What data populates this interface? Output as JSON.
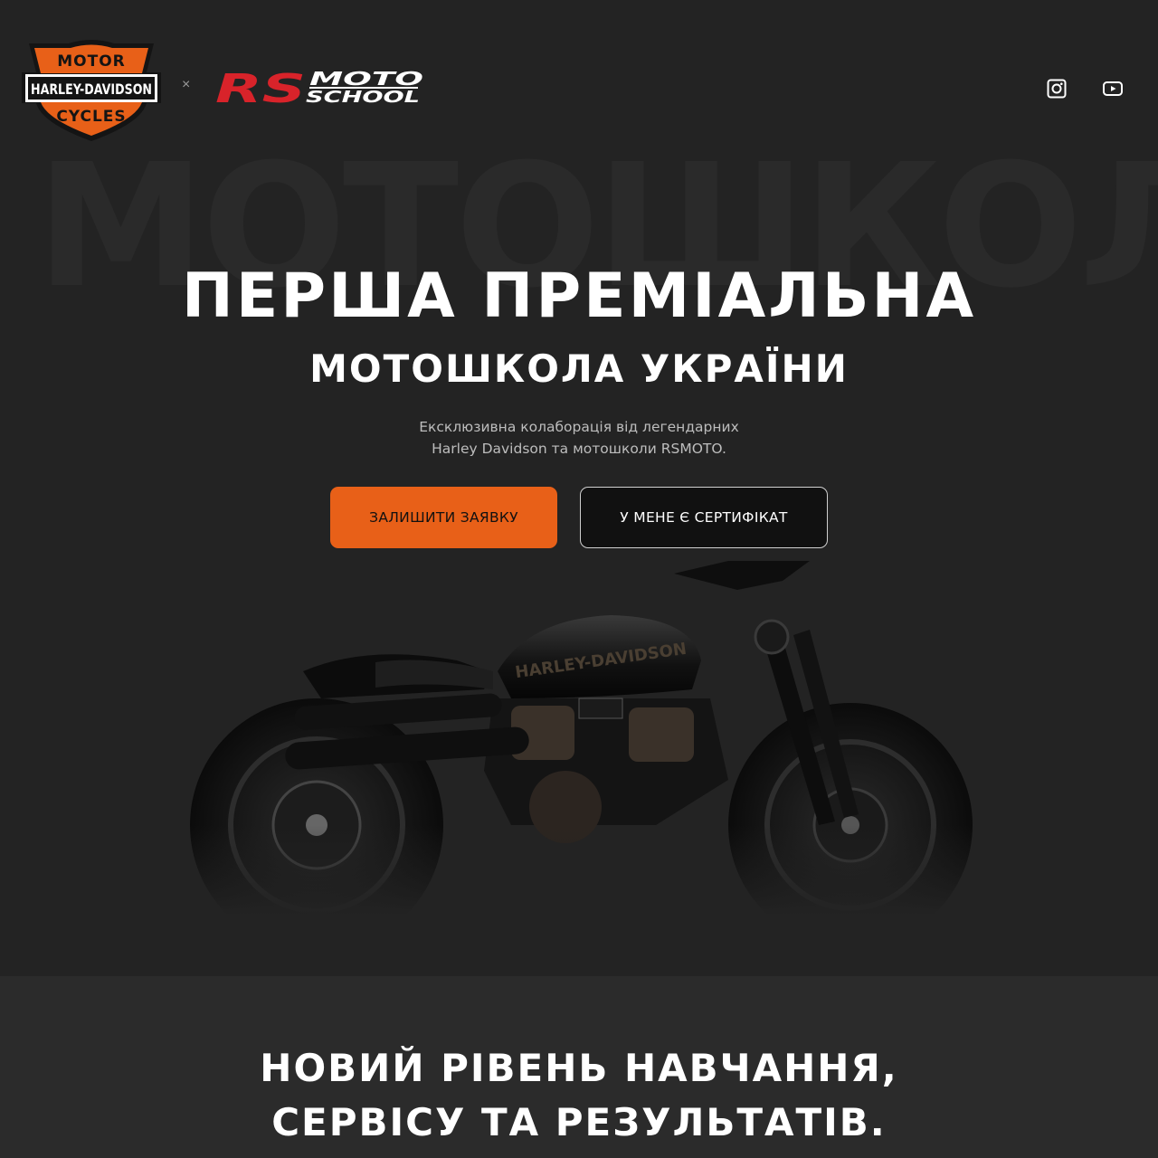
{
  "header": {
    "brand_left": {
      "top": "MOTOR",
      "middle": "HARLEY-DAVIDSON",
      "bottom": "CYCLES"
    },
    "separator": "×",
    "brand_right": {
      "primary": "RS",
      "secondary_top": "MOTO",
      "secondary_bottom": "SCHOOL"
    },
    "social": [
      {
        "name": "instagram-icon"
      },
      {
        "name": "youtube-icon"
      }
    ]
  },
  "hero": {
    "background_word": "МОТОШКОЛА",
    "title": "ПЕРША ПРЕМІАЛЬНА",
    "subtitle": "МОТОШКОЛА УКРАЇНИ",
    "description_lines": [
      "Ексклюзивна колаборація від легендарних",
      "Harley Davidson та мотошколи RSMOTO."
    ],
    "cta_primary": "ЗАЛИШИТИ ЗАЯВКУ",
    "cta_secondary": "У МЕНЕ Є СЕРТИФІКАТ",
    "motorcycle_tank_text": "HARLEY-DAVIDSON"
  },
  "section2": {
    "title_lines": [
      "НОВИЙ РІВЕНЬ НАВЧАННЯ,",
      "СЕРВІСУ ТА РЕЗУЛЬТАТІВ."
    ]
  },
  "colors": {
    "background": "#232323",
    "section_background": "#2b2b2b",
    "accent_orange": "#e86018",
    "rs_red": "#d8232a"
  }
}
